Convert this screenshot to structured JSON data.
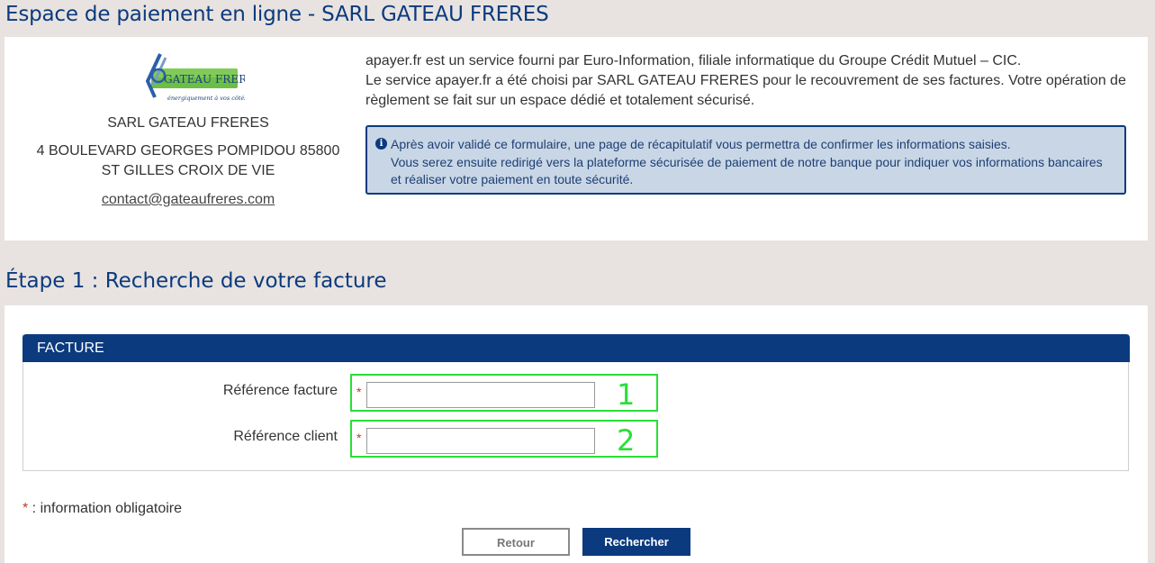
{
  "page": {
    "title": "Espace de paiement en ligne - SARL GATEAU FRERES"
  },
  "merchant": {
    "logo_text": "GATEAU FRERES",
    "logo_tagline": "énergiquement à vos côtés",
    "name": "SARL GATEAU FRERES",
    "address": "4 BOULEVARD GEORGES POMPIDOU 85800 ST GILLES CROIX DE VIE",
    "email": "contact@gateaufreres.com"
  },
  "service": {
    "line1": "apayer.fr est un service fourni par Euro-Information, filiale informatique du Groupe Crédit Mutuel – CIC.",
    "line2": "Le service apayer.fr a été choisi par SARL GATEAU FRERES pour le recouvrement de ses factures. Votre opération de règlement se fait sur un espace dédié et totalement sécurisé."
  },
  "info_box": {
    "icon": "info-icon",
    "line1": "Après avoir validé ce formulaire, une page de récapitulatif vous permettra de confirmer les informations saisies.",
    "line2": "Vous serez ensuite redirigé vers la plateforme sécurisée de paiement de notre banque pour indiquer vos informations bancaires et réaliser votre paiement en toute sécurité."
  },
  "step": {
    "title": "Étape 1 : Recherche de votre facture"
  },
  "facture": {
    "header": "FACTURE",
    "fields": [
      {
        "label": "Référence facture",
        "required_mark": "*",
        "value": "",
        "annotation": "1"
      },
      {
        "label": "Référence client",
        "required_mark": "*",
        "value": "",
        "annotation": "2"
      }
    ]
  },
  "required_note": {
    "star": "*",
    "text": " : information obligatoire"
  },
  "buttons": {
    "back": "Retour",
    "search": "Rechercher"
  },
  "colors": {
    "brand_blue": "#0b3a7e",
    "info_bg": "#c8d6e6",
    "annotation_green": "#27e035",
    "required_red": "#c0392b",
    "page_bg": "#e8e3e0"
  }
}
